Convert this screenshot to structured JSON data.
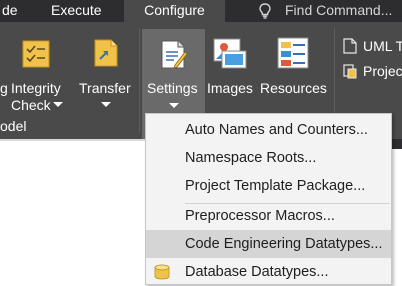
{
  "tabs": {
    "de": "de",
    "execute": "Execute",
    "configure": "Configure"
  },
  "find": {
    "text": "Find Command..."
  },
  "ribbon": {
    "integrity_check_line1": "Integrity",
    "integrity_check_line2": "Check",
    "integrity_check_prefix": "g",
    "transfer": "Transfer",
    "settings": "Settings",
    "images": "Images",
    "resources": "Resources",
    "group_label": "odel",
    "uml": "UML T",
    "project": "Projec"
  },
  "menu": {
    "items": [
      "Auto Names and Counters...",
      "Namespace Roots...",
      "Project Template Package...",
      "Preprocessor Macros...",
      "Code Engineering Datatypes...",
      "Database Datatypes..."
    ]
  },
  "colors": {
    "tab_bar": "#2d2d30",
    "ribbon": "#4a4a4a",
    "menu_bg": "#f3f3f3",
    "menu_highlight": "#d5d5d5"
  },
  "icons": {
    "find": "lightbulb-icon",
    "integrity_check": "checklist-icon",
    "transfer": "transfer-icon",
    "settings": "settings-icon",
    "images": "images-icon",
    "resources": "resources-icon",
    "uml": "uml-icon",
    "project": "project-icon",
    "database_datatypes": "database-icon"
  }
}
